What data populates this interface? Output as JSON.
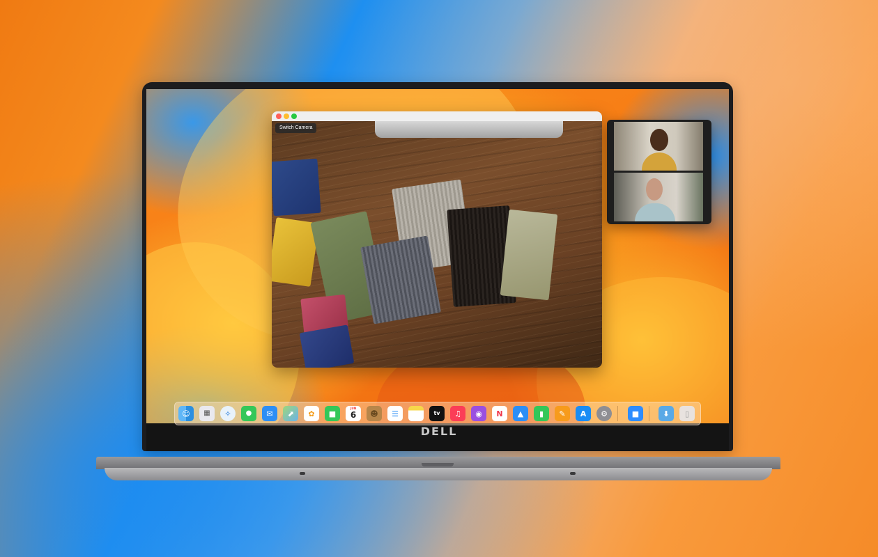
{
  "facetime": {
    "switch_camera_label": "Switch Camera"
  },
  "laptop": {
    "brand": "DELL"
  },
  "dock": {
    "calendar": {
      "month": "JUN",
      "day": "6"
    },
    "apple_tv_label": "tv",
    "items": [
      "Finder",
      "Launchpad",
      "Safari",
      "Messages",
      "Mail",
      "Maps",
      "Photos",
      "FaceTime",
      "Calendar",
      "Contacts",
      "Reminders",
      "Notes",
      "TV",
      "Music",
      "Podcasts",
      "News",
      "Keynote",
      "Numbers",
      "Pages",
      "App Store",
      "System Settings",
      "Zoom",
      "Downloads",
      "Trash"
    ]
  },
  "colors": {
    "traffic_close": "#fe5f57",
    "traffic_minimize": "#febc2e",
    "traffic_zoom": "#28c840"
  }
}
